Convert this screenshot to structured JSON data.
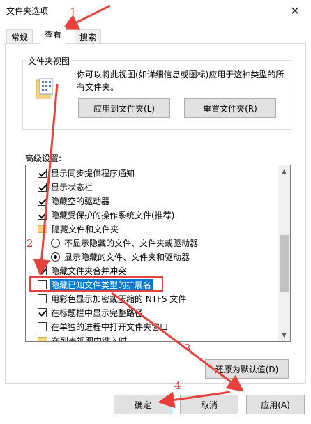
{
  "window": {
    "title": "文件夹选项",
    "close_glyph": "✕"
  },
  "tabs": [
    {
      "label": "常规"
    },
    {
      "label": "查看"
    },
    {
      "label": "搜索"
    }
  ],
  "folder_views": {
    "group_label": "文件夹视图",
    "description": "你可以将此视图(如详细信息或图标)应用于这种类型的所有文件夹。",
    "apply_button": "应用到文件夹(L)",
    "reset_button": "重置文件夹(R)"
  },
  "advanced": {
    "label": "高级设置:",
    "items": [
      {
        "type": "checkbox",
        "checked": true,
        "label": "显示同步提供程序通知"
      },
      {
        "type": "checkbox",
        "checked": true,
        "label": "显示状态栏"
      },
      {
        "type": "checkbox",
        "checked": true,
        "label": "隐藏空的驱动器"
      },
      {
        "type": "checkbox",
        "checked": true,
        "label": "隐藏受保护的操作系统文件(推荐)"
      },
      {
        "type": "folder",
        "label": "隐藏文件和文件夹"
      },
      {
        "type": "radio",
        "checked": false,
        "label": "不显示隐藏的文件、文件夹或驱动器"
      },
      {
        "type": "radio",
        "checked": true,
        "label": "显示隐藏的文件、文件夹和驱动器"
      },
      {
        "type": "checkbox",
        "checked": true,
        "label": "隐藏文件夹合并冲突"
      },
      {
        "type": "checkbox",
        "checked": false,
        "label": "隐藏已知文件类型的扩展名",
        "selected": true
      },
      {
        "type": "checkbox",
        "checked": false,
        "label": "用彩色显示加密或压缩的 NTFS 文件"
      },
      {
        "type": "checkbox",
        "checked": true,
        "label": "在标题栏中显示完整路径"
      },
      {
        "type": "checkbox",
        "checked": false,
        "label": "在单独的进程中打开文件夹窗口"
      },
      {
        "type": "folder",
        "label": "在列表视图中键入时"
      }
    ],
    "restore_button": "还原为默认值(D)"
  },
  "footer": {
    "ok": "确定",
    "cancel": "取消",
    "apply": "应用(A)"
  },
  "annotations": {
    "a1": "1",
    "a2": "2",
    "a3": "3",
    "a4": "4"
  },
  "colors": {
    "accent": "#0078d7",
    "annotation": "#e8403a"
  }
}
